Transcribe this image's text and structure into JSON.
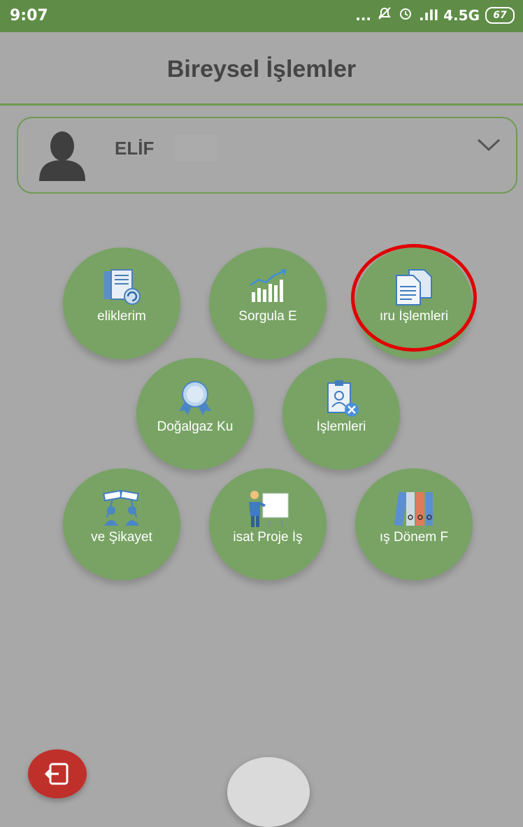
{
  "status_bar": {
    "time": "9:07",
    "indicators": "... ",
    "signal": ".ıll 4.5G",
    "battery": "67"
  },
  "header": {
    "title": "Bireysel İşlemler"
  },
  "user": {
    "name": "ELİF",
    "expand_icon": "chevron-down-icon"
  },
  "menu": {
    "items": [
      {
        "label": "eliklerim",
        "icon": "subscriptions-icon"
      },
      {
        "label": "Sorgula    E",
        "icon": "chart-icon"
      },
      {
        "label": "ıru İşlemleri",
        "icon": "documents-icon"
      },
      {
        "label": "Doğalgaz Ku",
        "icon": "award-icon"
      },
      {
        "label": "İşlemleri",
        "icon": "cancel-subscription-icon"
      },
      {
        "label": "ve Şikayet",
        "icon": "complaint-icon"
      },
      {
        "label": "isat Proje İş",
        "icon": "presentation-icon"
      },
      {
        "label": "ış Dönem F",
        "icon": "binders-icon"
      }
    ]
  },
  "colors": {
    "status_bar": "#5f8d47",
    "tile": "#78a364",
    "highlight": "#e00000",
    "logout": "#c0302b"
  }
}
